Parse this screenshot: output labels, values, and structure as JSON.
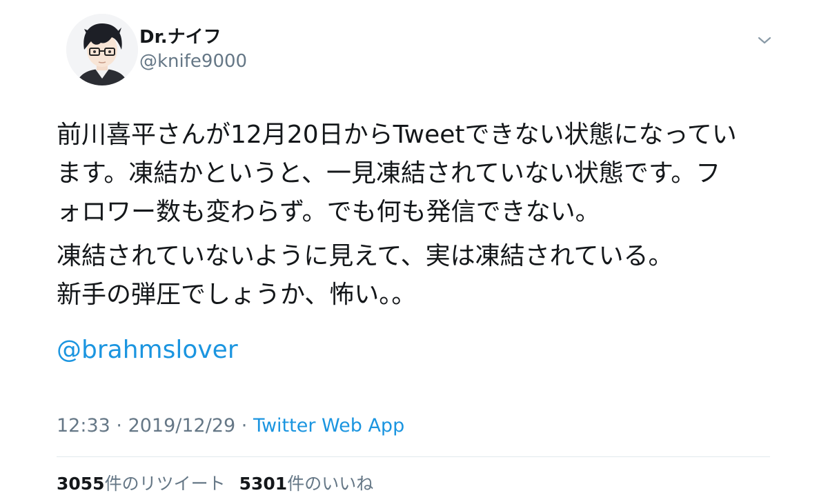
{
  "author": {
    "display_name": "Dr.ナイフ",
    "handle": "@knife9000",
    "avatar_icon": "avatar-portrait"
  },
  "menu_icon": "chevron-down-icon",
  "tweet": {
    "lines": [
      "前川喜平さんが12月20日からTweetできない状態になってい",
      "ます。凍結かというと、一見凍結されていない状態です。フ",
      "ォロワー数も変わらず。でも何も発信できない。",
      "凍結されていないように見えて、実は凍結されている。",
      "新手の弾圧でしょうか、怖い。。"
    ],
    "mention": "@brahmslover"
  },
  "meta": {
    "time": "12:33",
    "sep1": " · ",
    "date": "2019/12/29",
    "sep2": " · ",
    "source": "Twitter Web App"
  },
  "stats": {
    "retweets_count": "3055",
    "retweets_label": "件のリツイート",
    "likes_count": "5301",
    "likes_label": "件のいいね"
  },
  "colors": {
    "text": "#14171a",
    "secondary": "#657786",
    "link": "#1b95e0",
    "divider": "#e1e8ed"
  }
}
